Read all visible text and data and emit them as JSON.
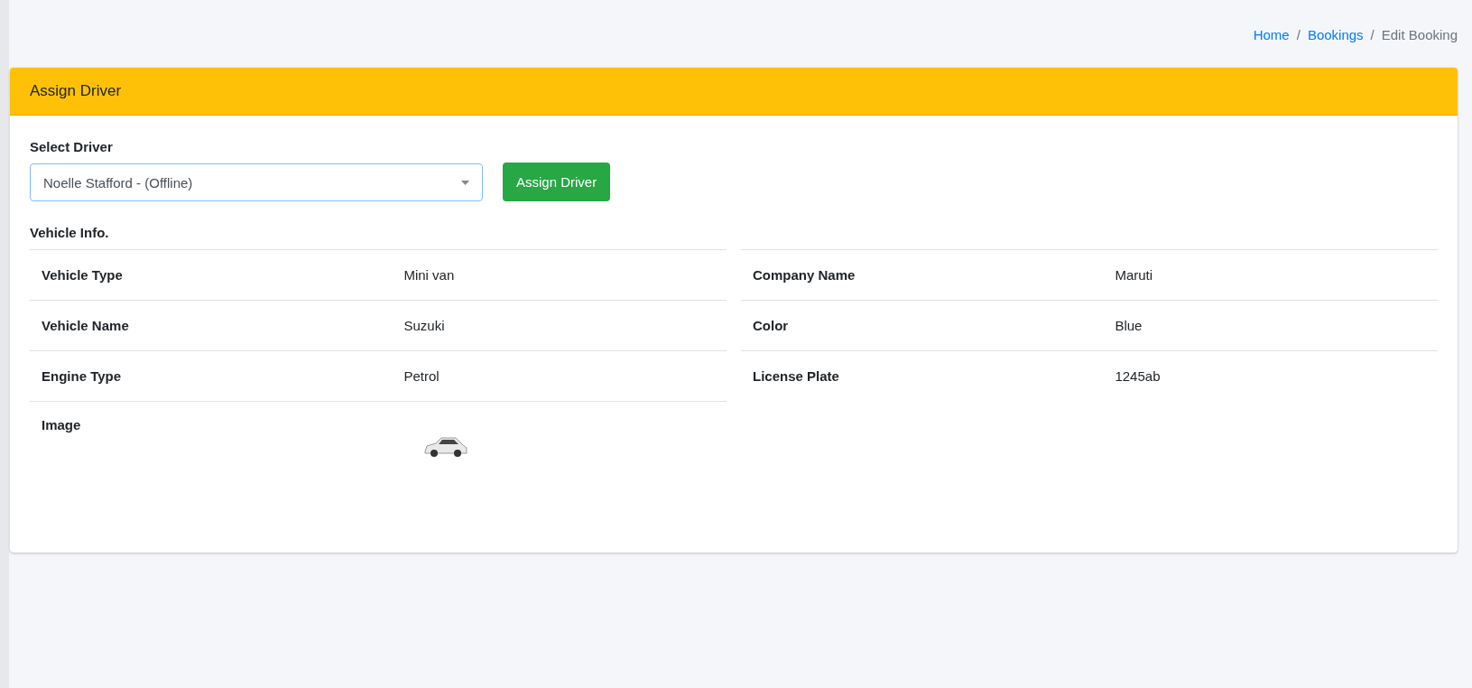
{
  "breadcrumb": [
    {
      "label": "Home",
      "kind": "link"
    },
    {
      "label": "/",
      "kind": "separator"
    },
    {
      "label": "Bookings",
      "kind": "link"
    },
    {
      "label": "/",
      "kind": "separator"
    },
    {
      "label": "Edit Booking",
      "kind": "current"
    }
  ],
  "card": {
    "title": "Assign Driver"
  },
  "driver_select": {
    "label": "Select Driver",
    "value": "Noelle Stafford - (Offline)"
  },
  "assign_button": "Assign Driver",
  "vehicle_info": {
    "heading": "Vehicle Info.",
    "left_rows": [
      {
        "label": "Vehicle Type",
        "value": "Mini van",
        "kind": "text"
      },
      {
        "label": "Vehicle Name",
        "value": "Suzuki",
        "kind": "text"
      },
      {
        "label": "Engine Type",
        "value": "Petrol",
        "kind": "text"
      },
      {
        "label": "Image",
        "kind": "image"
      }
    ],
    "right_rows": [
      {
        "label": "Company Name",
        "value": "Maruti",
        "kind": "text"
      },
      {
        "label": "Color",
        "value": "Blue",
        "kind": "text"
      },
      {
        "label": "License Plate",
        "value": "1245ab",
        "kind": "text"
      }
    ]
  }
}
